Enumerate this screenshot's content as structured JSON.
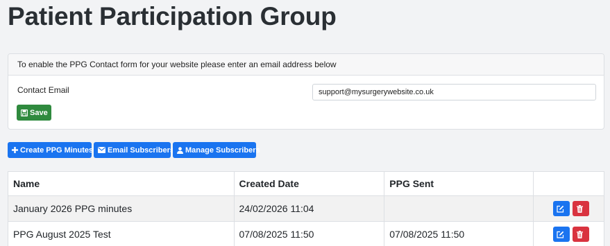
{
  "page": {
    "title": "Patient Participation Group"
  },
  "contact_card": {
    "header": "To enable the PPG Contact form for your website please enter an email address below",
    "email_label": "Contact Email",
    "email_value": "support@mysurgerywebsite.co.uk",
    "save_label": "Save"
  },
  "toolbar": {
    "create_label": "Create PPG Minutes",
    "email_label": "Email Subscribers",
    "manage_label": "Manage Subscribers"
  },
  "table": {
    "headers": [
      "Name",
      "Created Date",
      "PPG Sent",
      ""
    ],
    "rows": [
      {
        "name": "January 2026 PPG minutes",
        "created": "24/02/2026 11:04",
        "sent": ""
      },
      {
        "name": "PPG August 2025 Test",
        "created": "07/08/2025 11:50",
        "sent": "07/08/2025 11:50"
      }
    ]
  },
  "colors": {
    "primary": "#1a74f0",
    "success": "#2f8a3e",
    "danger": "#d9333f"
  },
  "icons": [
    "save-icon",
    "plus-icon",
    "envelope-icon",
    "user-icon",
    "edit-icon",
    "trash-icon"
  ]
}
